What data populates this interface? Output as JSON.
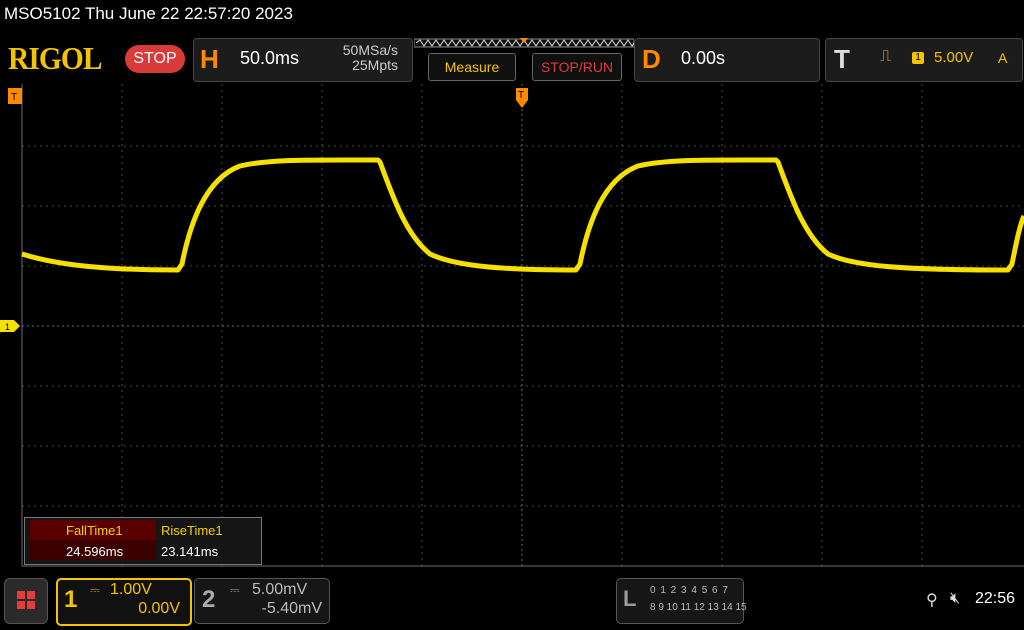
{
  "header": {
    "title_line": "MSO5102  Thu June 22 22:57:20 2023"
  },
  "toolbar": {
    "logo": "RIGOL",
    "run_state": "STOP",
    "horizontal": {
      "letter": "H",
      "timebase": "50.0ms",
      "sample_rate": "50MSa/s",
      "memory_depth": "25Mpts"
    },
    "measure_label": "Measure",
    "stoprun_label": "STOP/RUN",
    "delay": {
      "letter": "D",
      "value": "0.00s"
    },
    "trigger": {
      "letter": "T",
      "edge_icon": "rising-edge-icon",
      "source": "1",
      "level": "5.00V",
      "mode": "A"
    }
  },
  "screen": {
    "channel_marker": "1",
    "trace_color": "#f5e000",
    "grid_color": "#4a4a4a"
  },
  "measurements": {
    "headers": [
      "FallTime1",
      "RiseTime1"
    ],
    "values": [
      "24.596ms",
      "23.141ms"
    ]
  },
  "bottom": {
    "ch1": {
      "number": "1",
      "scale": "1.00V",
      "offset": "0.00V",
      "coupling_icon": "dc-coupling-icon"
    },
    "ch2": {
      "number": "2",
      "scale": "5.00mV",
      "offset": "-5.40mV",
      "coupling_icon": "dc-coupling-icon"
    },
    "logic": {
      "letter": "L",
      "row1": "0 1 2 3  4 5 6 7",
      "row2": "8 9 10 11 12 13 14 15"
    },
    "clock": "22:56"
  },
  "colors": {
    "accent_yellow": "#f5c400",
    "accent_orange": "#ff8a00",
    "stop_red": "#d93a3a"
  }
}
